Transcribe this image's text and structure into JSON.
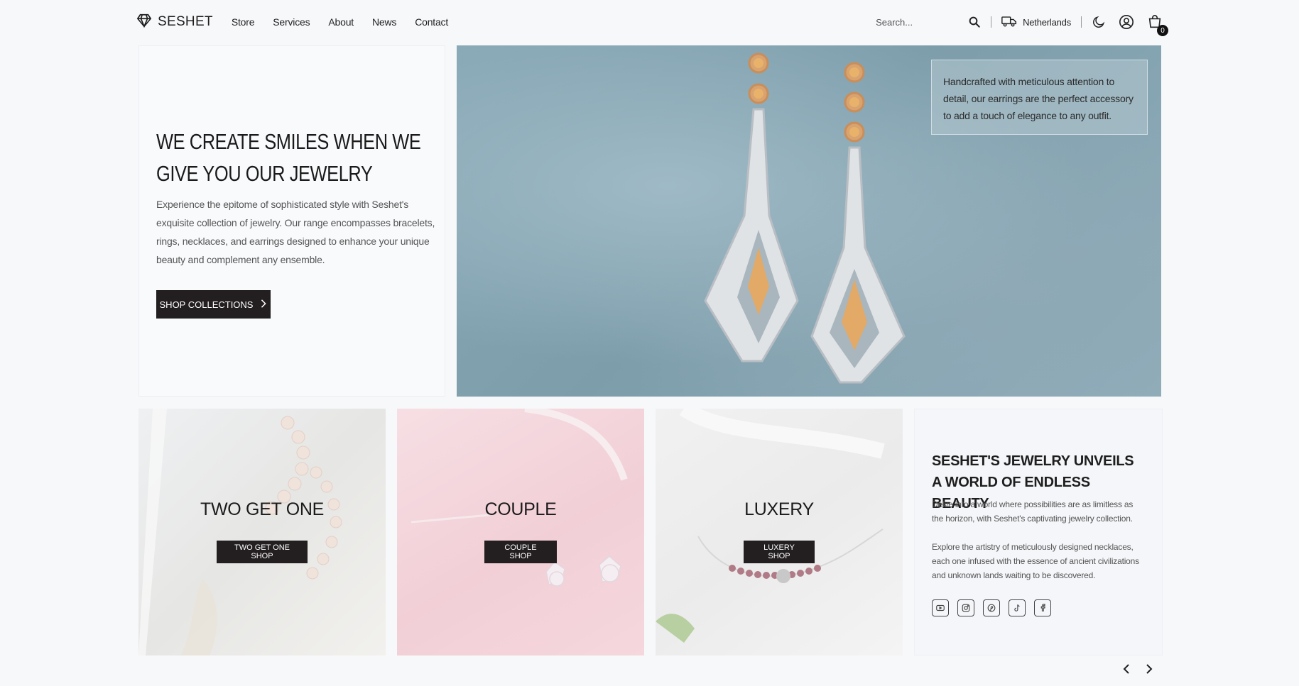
{
  "brand": {
    "name": "SESHET"
  },
  "nav": {
    "items": [
      {
        "label": "Store"
      },
      {
        "label": "Services"
      },
      {
        "label": "About"
      },
      {
        "label": "News"
      },
      {
        "label": "Contact"
      }
    ]
  },
  "header": {
    "search_placeholder": "Search...",
    "country": "Netherlands",
    "cart_count": "0"
  },
  "hero": {
    "title": "WE CREATE SMILES WHEN WE GIVE YOU OUR JEWELRY",
    "description": "Experience the epitome of sophisticated style with Seshet's exquisite collection of jewelry. Our range encompasses bracelets, rings, necklaces, and earrings designed to enhance your unique beauty and complement any ensemble.",
    "button_label": "SHOP COLLECTIONS",
    "quote": "Handcrafted with meticulous attention to detail, our earrings are the perfect accessory to add a touch of elegance to any outfit."
  },
  "categories": [
    {
      "title": "TWO GET ONE",
      "button": "TWO GET ONE SHOP"
    },
    {
      "title": "COUPLE",
      "button": "COUPLE SHOP"
    },
    {
      "title": "LUXERY",
      "button": "LUXERY SHOP"
    }
  ],
  "info": {
    "title": "SESHET'S JEWELRY UNVEILS A WORLD OF ENDLESS BEAUTY",
    "paragraph1": "Delve into a world where possibilities are as limitless as the horizon, with Seshet's captivating jewelry collection.",
    "paragraph2": "Explore the artistry of meticulously designed necklaces, each one infused with the essence of ancient civilizations and unknown lands waiting to be discovered.",
    "social_icons": [
      "youtube-icon",
      "instagram-icon",
      "pinterest-icon",
      "tiktok-icon",
      "facebook-icon"
    ]
  },
  "colors": {
    "dark_button": "#231f20",
    "background": "#f7f8fa",
    "hero_blue": "#88a8b6"
  }
}
